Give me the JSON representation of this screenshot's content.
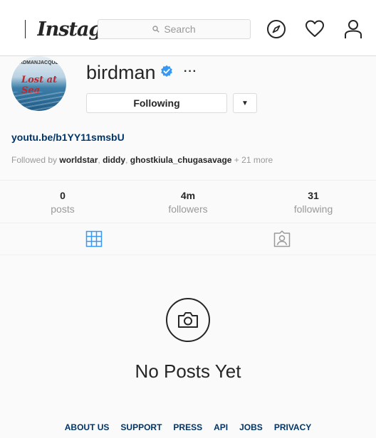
{
  "nav": {
    "logo": "Instagram",
    "search_placeholder": "Search"
  },
  "profile": {
    "username": "birdman",
    "follow_label": "Following",
    "dropdown_glyph": "▼",
    "more_glyph": "···",
    "avatar_top_left": "BIRDMAN",
    "avatar_top_right": "JACQUEES",
    "avatar_title": "Lost at Sea",
    "link": "youtu.be/b1YY11smsbU",
    "followed_by_prefix": "Followed by",
    "followed_by_names": [
      "worldstar",
      "diddy",
      "ghostkiula_chugasavage"
    ],
    "followed_by_more": "+ 21 more"
  },
  "stats": [
    {
      "value": "0",
      "label": "posts"
    },
    {
      "value": "4m",
      "label": "followers"
    },
    {
      "value": "31",
      "label": "following"
    }
  ],
  "empty_state": {
    "title": "No Posts Yet"
  },
  "footer": {
    "links": [
      "ABOUT US",
      "SUPPORT",
      "PRESS",
      "API",
      "JOBS",
      "PRIVACY"
    ]
  },
  "colors": {
    "verified": "#3897f0",
    "link": "#003569",
    "active_tab": "#3897f0"
  }
}
